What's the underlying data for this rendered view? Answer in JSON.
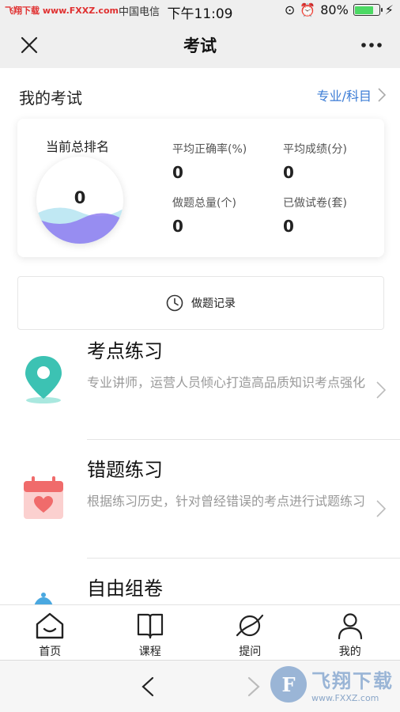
{
  "status_bar": {
    "left_watermark": "飞翔下载 www.FXXZ.com",
    "carrier": "中国电信",
    "time": "下午11:09",
    "battery": "80%",
    "battery_level": 0.8
  },
  "nav": {
    "title": "考试",
    "close_icon": "close-icon",
    "more_icon": "more-icon"
  },
  "my_exam": {
    "title": "我的考试",
    "link": "专业/科目"
  },
  "stats": {
    "rank_label": "当前总排名",
    "rank_value": "0",
    "accuracy_label": "平均正确率(%)",
    "accuracy_value": "0",
    "avg_score_label": "平均成绩(分)",
    "avg_score_value": "0",
    "total_questions_label": "做题总量(个)",
    "total_questions_value": "0",
    "papers_done_label": "已做试卷(套)",
    "papers_done_value": "0"
  },
  "record": {
    "label": "做题记录",
    "icon": "clock-icon"
  },
  "features": [
    {
      "title": "考点练习",
      "desc": "专业讲师，运营人员倾心打造高品质知识考点强化",
      "icon": "location-pin-icon",
      "color": "#3cc2b3"
    },
    {
      "title": "错题练习",
      "desc": "根据练习历史，针对曾经错误的考点进行试题练习",
      "icon": "calendar-heart-icon",
      "color": "#f06b6b"
    },
    {
      "title": "自由组卷",
      "icon": "bell-icon",
      "color": "#4aa8e0"
    }
  ],
  "tabbar": {
    "tabs": [
      {
        "label": "首页",
        "icon": "home-icon"
      },
      {
        "label": "课程",
        "icon": "book-icon"
      },
      {
        "label": "提问",
        "icon": "planet-icon"
      },
      {
        "label": "我的",
        "icon": "user-icon"
      }
    ]
  },
  "browser": {
    "back_icon": "chevron-left-icon",
    "forward_icon": "chevron-right-icon",
    "watermark_title": "飞翔下载",
    "watermark_url": "www.FXXZ.com"
  },
  "colors": {
    "accent_link": "#3a7bd5",
    "wave": "#8f7cf0"
  }
}
